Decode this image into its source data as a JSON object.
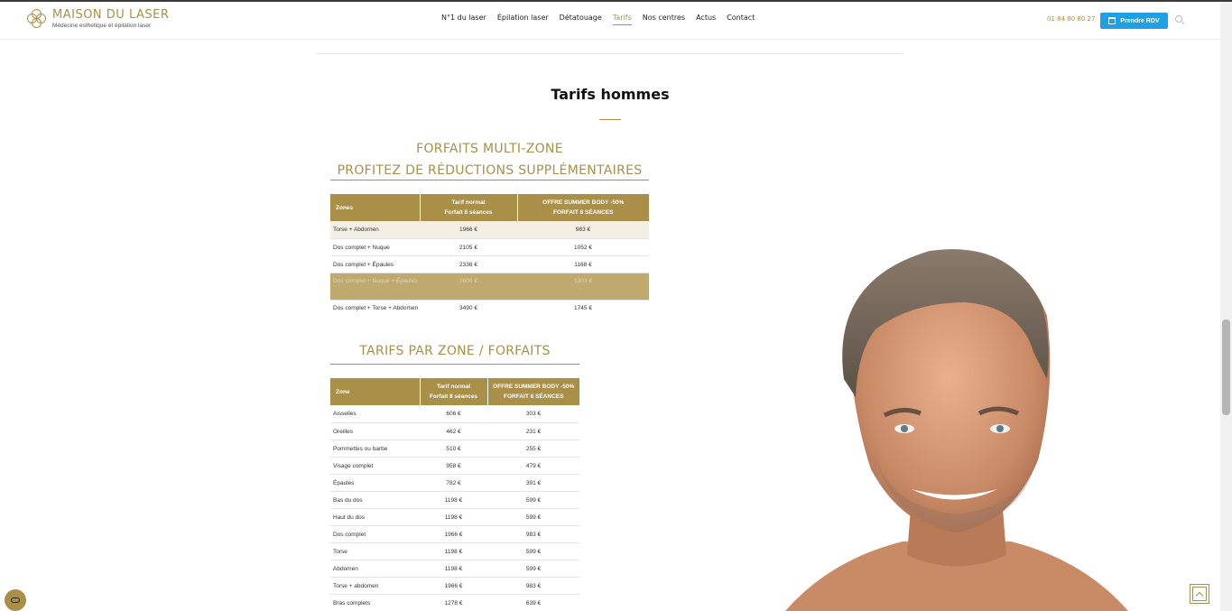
{
  "brand": {
    "name": "MAISON DU LASER",
    "tagline": "Médecine esthetique et épilation laser"
  },
  "nav": [
    {
      "label": "N°1 du laser"
    },
    {
      "label": "Épilation laser"
    },
    {
      "label": "Détatouage"
    },
    {
      "label": "Tarifs",
      "active": true
    },
    {
      "label": "Nos centres"
    },
    {
      "label": "Actus"
    },
    {
      "label": "Contact"
    }
  ],
  "header": {
    "phone": "01 84 80 80 27",
    "cta_label": "Prendre RDV"
  },
  "section": {
    "title": "Tarifs hommes"
  },
  "multi": {
    "heading_line1": "FORFAITS MULTI-ZONE",
    "heading_line2": "PROFITEZ DE RÉDUCTIONS SUPPLÉMENTAIRES",
    "col_zone": "Zones",
    "col_normal_1": "Tarif normal",
    "col_normal_2": "Forfait 8 séances",
    "col_offer_1": "OFFRE SUMMER BODY -50%",
    "col_offer_2": "FORFAIT 8 SÉANCES",
    "rows": [
      {
        "zone": "Torse + Abdomen",
        "normal": "1966 €",
        "offer": "983 €"
      },
      {
        "zone": "Dos complet + Nuque",
        "normal": "2105 €",
        "offer": "1052 €"
      },
      {
        "zone": "Dos complet + Épaules",
        "normal": "2336 €",
        "offer": "1168 €"
      },
      {
        "zone": "Dos complet + Nuque + Épaules",
        "normal": "2606 €",
        "offer": "1303 €"
      },
      {
        "zone": "Dos complet + Torse + Abdomen",
        "normal": "3490 €",
        "offer": "1745 €"
      }
    ]
  },
  "zones": {
    "heading": "TARIFS PAR ZONE / FORFAITS",
    "col_zone": "Zone",
    "col_normal_1": "Tarif normal",
    "col_normal_2": "Forfait 8 séances",
    "col_offer_1": "OFFRE SUMMER BODY -50%",
    "col_offer_2": "FORFAIT 8 SÉANCES",
    "rows": [
      {
        "zone": "Aisselles",
        "normal": "606 €",
        "offer": "303 €"
      },
      {
        "zone": "Oreilles",
        "normal": "462 €",
        "offer": "231 €"
      },
      {
        "zone": "Pommettes ou barbe",
        "normal": "510 €",
        "offer": "255 €"
      },
      {
        "zone": "Visage complet",
        "normal": "958 €",
        "offer": "479 €"
      },
      {
        "zone": "Épaules",
        "normal": "782 €",
        "offer": "391 €"
      },
      {
        "zone": "Bas du dos",
        "normal": "1198 €",
        "offer": "599 €"
      },
      {
        "zone": "Haut du dos",
        "normal": "1198 €",
        "offer": "599 €"
      },
      {
        "zone": "Dos complet",
        "normal": "1966 €",
        "offer": "983 €"
      },
      {
        "zone": "Torse",
        "normal": "1198 €",
        "offer": "599 €"
      },
      {
        "zone": "Abdomen",
        "normal": "1198 €",
        "offer": "599 €"
      },
      {
        "zone": "Torse + abdomen",
        "normal": "1966 €",
        "offer": "983 €"
      },
      {
        "zone": "Bras complets",
        "normal": "1278 €",
        "offer": "639 €"
      }
    ]
  },
  "colors": {
    "gold": "#a98f48",
    "cta_blue": "#1ea0e6"
  }
}
